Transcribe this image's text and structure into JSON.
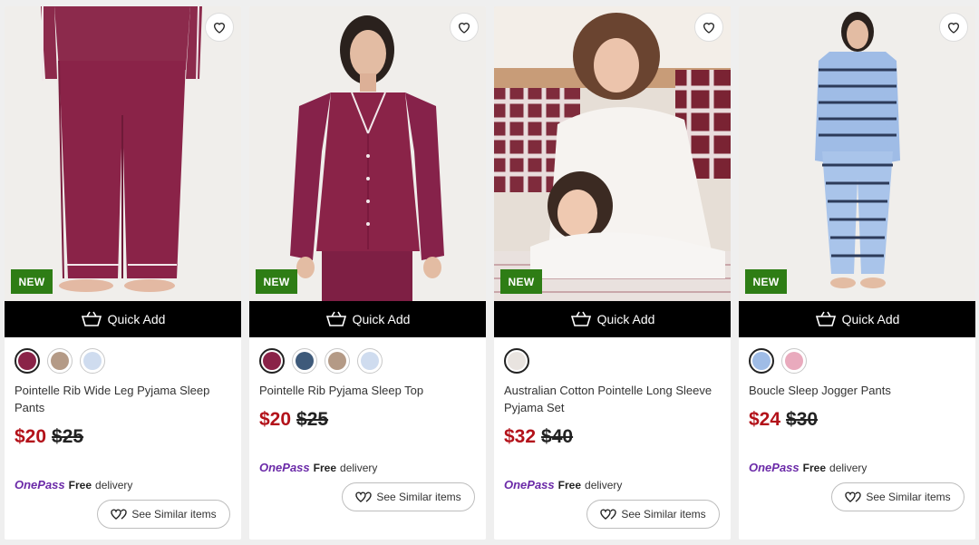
{
  "ui": {
    "quick_add": "Quick Add",
    "new_badge": "NEW",
    "onepass": "OnePass",
    "free": "Free",
    "delivery": "delivery",
    "see_similar": "See Similar items",
    "wishlist_icon": "heart-icon",
    "basket_icon": "basket-icon"
  },
  "colors": {
    "sale_price": "#b3121a",
    "new_badge": "#2e7d15",
    "onepass_brand": "#6b2aa8",
    "quick_add_bg": "#000000"
  },
  "products": [
    {
      "name": "Pointelle Rib Wide Leg Pyjama Sleep Pants",
      "price": "$20",
      "was_price": "$25",
      "is_new": true,
      "swatches": [
        "#8a2348",
        "#b49a86",
        "#cfdcef"
      ]
    },
    {
      "name": "Pointelle Rib Pyjama Sleep Top",
      "price": "$20",
      "was_price": "$25",
      "is_new": true,
      "swatches": [
        "#8a2348",
        "#3e5a7a",
        "#b49a86",
        "#cfdcef"
      ]
    },
    {
      "name": "Australian Cotton Pointelle Long Sleeve Pyjama Set",
      "price": "$32",
      "was_price": "$40",
      "is_new": true,
      "swatches": [
        "#e9e4e0"
      ]
    },
    {
      "name": "Boucle Sleep Jogger Pants",
      "price": "$24",
      "was_price": "$30",
      "is_new": true,
      "swatches": [
        "#9fbce6",
        "#e9aabd"
      ]
    }
  ]
}
